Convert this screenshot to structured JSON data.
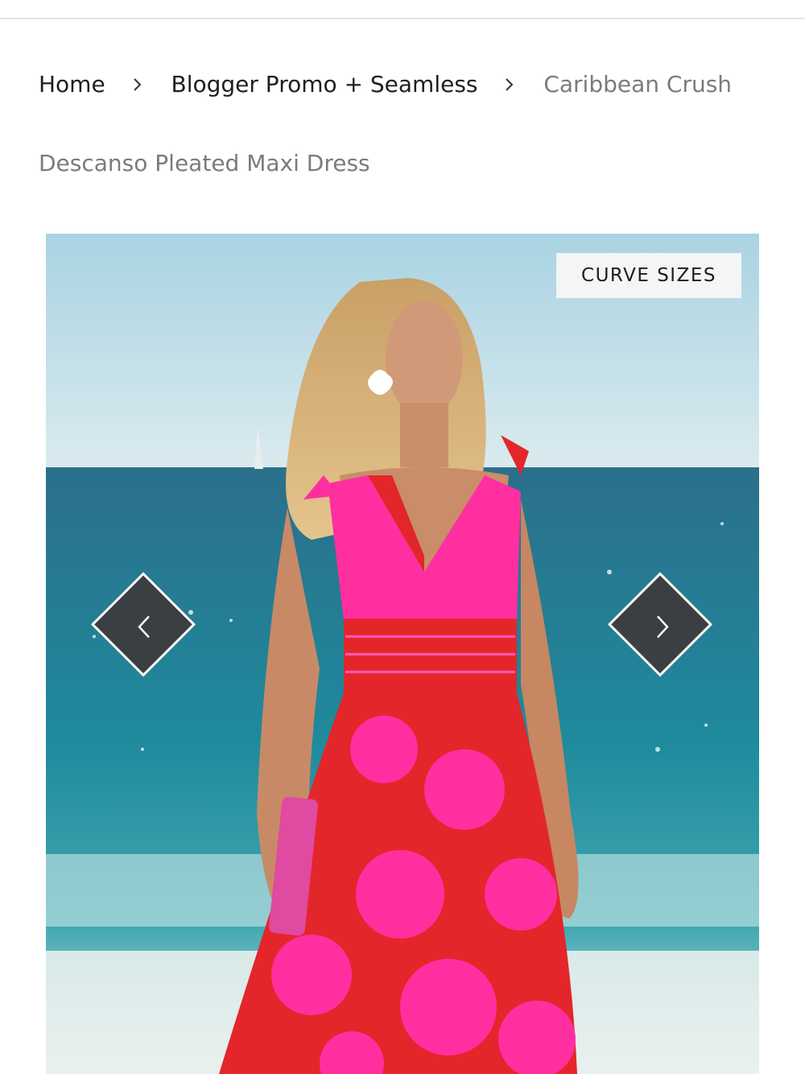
{
  "breadcrumb": {
    "items": [
      {
        "label": "Home"
      },
      {
        "label": "Blogger Promo + Seamless"
      },
      {
        "label": "Caribbean Crush"
      }
    ],
    "separator_icon": "chevron-right-icon"
  },
  "product": {
    "title": "Descanso Pleated Maxi Dress"
  },
  "gallery": {
    "badge": "CURVE SIZES",
    "prev_icon": "chevron-left-icon",
    "next_icon": "chevron-right-icon",
    "image": "model-in-pink-floral-maxi-dress-on-beach"
  },
  "colors": {
    "text_dark": "#1f1f1f",
    "text_muted": "#7b7b7b",
    "arrow_bg": "#3b3f41",
    "badge_bg": "#f3f5f6",
    "dress_pink": "#ff2fa0",
    "dress_red": "#e3262a",
    "sea": "#1f8a9c",
    "sky": "#bcdde6"
  }
}
